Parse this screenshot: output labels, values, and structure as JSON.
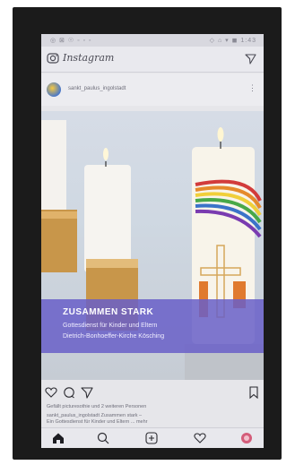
{
  "status_bar": {
    "left": "◎ ⊠ ☉ ◦ ◦ ◦",
    "right": "◇ ⌂ ▾ ◼ 1:43"
  },
  "app": {
    "wordmark": "Instagram"
  },
  "post": {
    "username": "sankt_paulus_ingolstadt",
    "overlay": {
      "title": "ZUSAMMEN STARK",
      "line1": "Gottesdienst für Kinder und Eltern",
      "line2": "Dietrich-Bonhoeffer-Kirche Kösching"
    },
    "likes": "Gefällt picturesothie und 2 weiteren Personen",
    "caption_user": "sankt_paulus_ingolstadt",
    "caption_text": "Zusammen stark –",
    "caption_line2": "Ein Gottesdienst für Kinder und Eltern ... mehr"
  },
  "colors": {
    "overlay": "#695fc8",
    "accent_orange": "#e07a2e"
  },
  "icons": {
    "camera": "camera-icon",
    "direct": "direct-icon",
    "more": "more-icon",
    "like": "heart-icon",
    "comment": "comment-icon",
    "share": "send-icon",
    "save": "bookmark-icon",
    "home": "home-icon",
    "search": "search-icon",
    "add": "plus-icon",
    "activity": "heart-icon",
    "profile": "profile-icon"
  }
}
